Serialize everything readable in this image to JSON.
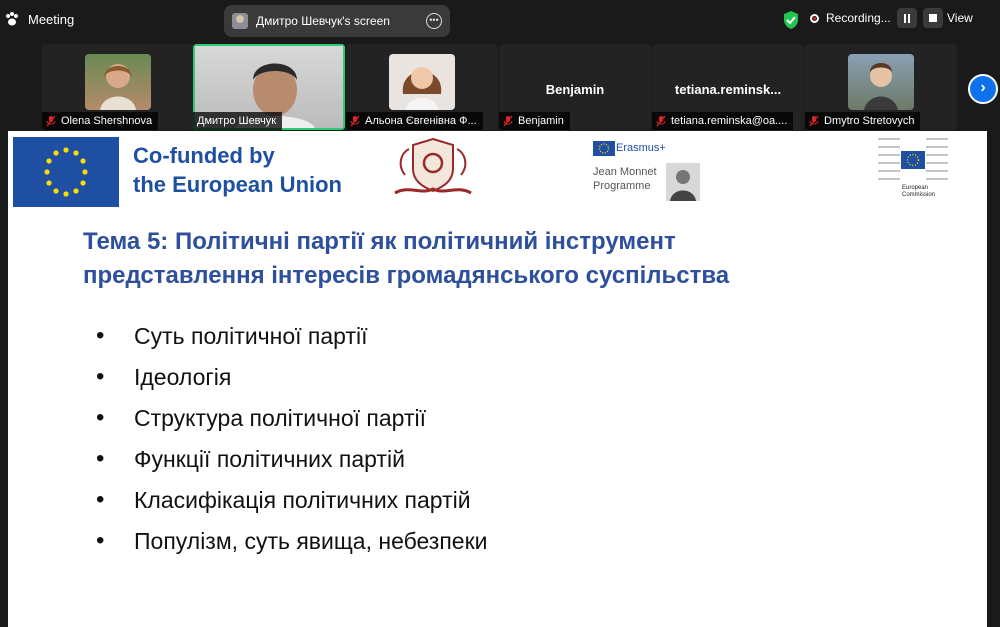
{
  "topbar": {
    "meeting_label": "Meeting",
    "share_label": "Дмитро Шевчук's screen",
    "recording_label": "Recording...",
    "view_label": "View"
  },
  "participants": [
    {
      "name": "Olena Shershnova",
      "muted": true
    },
    {
      "name": "Дмитро Шевчук",
      "muted": false,
      "active": true
    },
    {
      "name": "Альона Євгенівна Ф...",
      "muted": true
    },
    {
      "name": "Benjamin",
      "muted": true,
      "display": "Benjamin"
    },
    {
      "name": "tetiana.reminska@oa....",
      "muted": true,
      "display": "tetiana.reminsk..."
    },
    {
      "name": "Dmytro Stretovych",
      "muted": true
    }
  ],
  "slide": {
    "cofunded_line1": "Co-funded by",
    "cofunded_line2": "the European Union",
    "erasmus_label": "Erasmus+",
    "jean_monnet_line1": "Jean Monnet",
    "jean_monnet_line2": "Programme",
    "ec_line1": "European",
    "ec_line2": "Commission",
    "title_line1": "Тема 5: Політичні партії як політичний інструмент",
    "title_line2": "представлення інтересів громадянського суспільства",
    "bullets": [
      "Суть політичної партії",
      "Ідеологія",
      "Структура політичної партії",
      "Функції політичних партій",
      "Класифікація політичних партій",
      "Популізм, суть явища, небезпеки"
    ]
  },
  "colors": {
    "eu_blue": "#1e4fa3",
    "title_blue": "#2d4f9c",
    "active_speaker": "#2ecc71",
    "zoom_blue": "#0e72ed",
    "mic_muted": "#e02424"
  }
}
